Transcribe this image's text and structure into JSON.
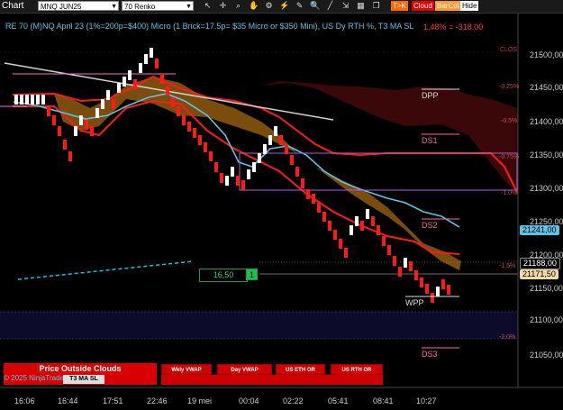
{
  "toolbar": {
    "chart_label": "Chart",
    "instrument": "MNQ JUN25",
    "bar_type": "70 Renko",
    "tool_icons": [
      "pointer-icon",
      "crosshair-icon",
      "zoom-icon",
      "hand-icon",
      "properties-icon",
      "strategy-icon",
      "drawing-icon",
      "search-icon",
      "draw-line-icon",
      "pan-icon",
      "tile-icon",
      "window-icon"
    ],
    "buttons": [
      {
        "label": "T>K",
        "bg": "#ff6a00",
        "color": "#ffffff"
      },
      {
        "label": "Cloud",
        "bg": "#e00000",
        "color": "#ffffff"
      },
      {
        "label": "BarCol",
        "bg": "#ff9a30",
        "color": "#ffffff"
      },
      {
        "label": "Hide",
        "bg": "#ffffff",
        "color": "#000000"
      }
    ]
  },
  "chart": {
    "title": "RE 70 (M)NQ April 23 (1%=200p=$400) Micro (1 Brick=17.5p= $35 Micro or $350 Mini), US Dy RTH %, T3 MA SL",
    "pnl": "1.48% = -318.00",
    "clos_label": "CLOS",
    "price_labels": [
      "21500,00",
      "21450,00",
      "21400,00",
      "21350,00",
      "21300,00",
      "21250,00",
      "21200,00",
      "21150,00",
      "21100,00",
      "21050,00"
    ],
    "tags": [
      {
        "text": "21241,00",
        "bg": "#5ec3e6",
        "color": "#000"
      },
      {
        "text": "21188,00",
        "bg": "#000000",
        "color": "#fff"
      },
      {
        "text": "21171,50",
        "bg": "#f0d9a6",
        "color": "#000"
      }
    ],
    "time_labels": [
      "16:06",
      "16:44",
      "17:51",
      "22:46",
      "19 mei",
      "00:04",
      "02:22",
      "05:41",
      "08:41",
      "10:27"
    ],
    "pct_labels": [
      "-0.25%",
      "-0.5%",
      "-0.75%",
      "-1.0%",
      "-1.5%",
      "-2.0%"
    ],
    "levels": [
      "DPP",
      "DS1",
      "DS2",
      "WPP",
      "DS3"
    ],
    "box_label": "16,50",
    "box_number": "1",
    "copyright": "© 2025 NinjaTrader, LLC",
    "overlay_label": "T3 MA SL",
    "controls": [
      "Price Outside Clouds",
      "Wkly VWAP",
      "Day VWAP",
      "US ETH OR",
      "US RTH OR"
    ]
  },
  "colors": {
    "bull": "#ffffff",
    "bear": "#ff1a1a",
    "cloud_orange": "#8a5a10",
    "cloud_red": "#4a0808",
    "ma": "#5ec3e6",
    "vwap_line": "#00c8e8"
  }
}
